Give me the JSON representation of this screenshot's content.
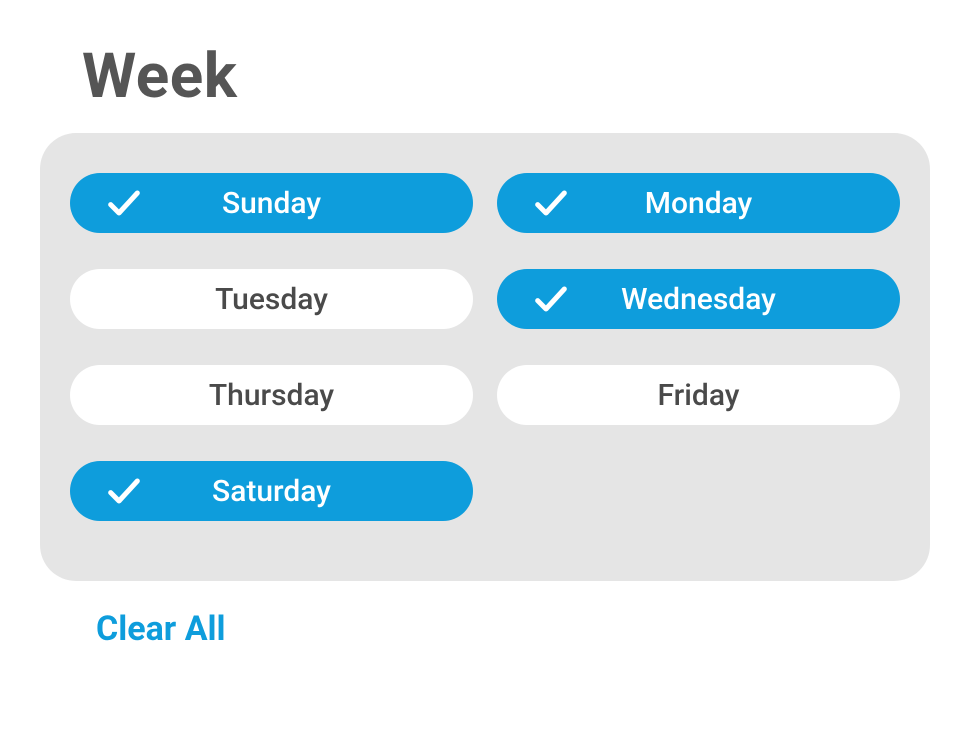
{
  "title": "Week",
  "days": [
    {
      "label": "Sunday",
      "selected": true
    },
    {
      "label": "Monday",
      "selected": true
    },
    {
      "label": "Tuesday",
      "selected": false
    },
    {
      "label": "Wednesday",
      "selected": true
    },
    {
      "label": "Thursday",
      "selected": false
    },
    {
      "label": "Friday",
      "selected": false
    },
    {
      "label": "Saturday",
      "selected": true
    }
  ],
  "clear_label": "Clear All",
  "colors": {
    "accent": "#0e9ddc",
    "panel_bg": "#e5e5e5",
    "text": "#4a4a4a"
  }
}
